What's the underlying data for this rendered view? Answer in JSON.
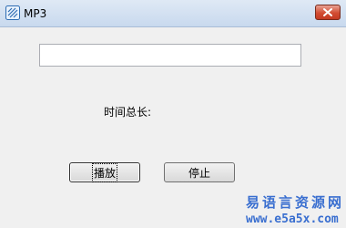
{
  "window": {
    "title": "MP3",
    "close_icon": "close-icon",
    "app_icon": "app-icon"
  },
  "main": {
    "path_field_value": "",
    "duration_label": "时间总长:",
    "play_label": "播放",
    "stop_label": "停止"
  },
  "watermark": {
    "site_name": "易语言资源网",
    "url": "www.e5a5x.com"
  },
  "colors": {
    "watermark": "#3a6fd0",
    "close_button": "#d24c32"
  }
}
